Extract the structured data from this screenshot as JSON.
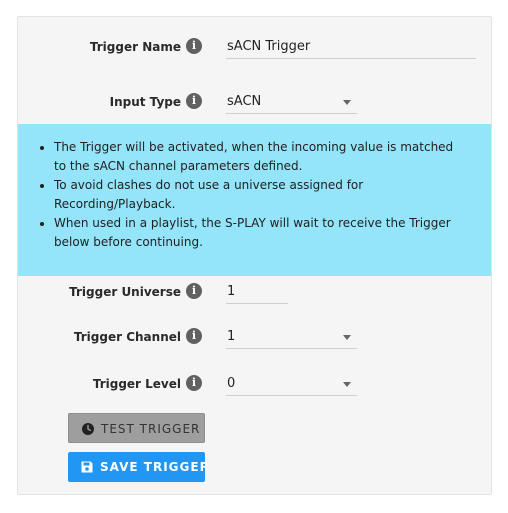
{
  "form": {
    "trigger_name": {
      "label": "Trigger Name",
      "value": "sACN Trigger"
    },
    "input_type": {
      "label": "Input Type",
      "value": "sACN"
    },
    "notice": [
      "The Trigger will be activated, when the incoming value is matched to the sACN channel parameters defined.",
      "To avoid clashes do not use a universe assigned for Recording/Playback.",
      "When used in a playlist, the S-PLAY will wait to receive the Trigger below before continuing."
    ],
    "trigger_universe": {
      "label": "Trigger Universe",
      "value": "1"
    },
    "trigger_channel": {
      "label": "Trigger Channel",
      "value": "1"
    },
    "trigger_level": {
      "label": "Trigger Level",
      "value": "0"
    },
    "info_glyph": "i",
    "test_button": "TEST TRIGGER",
    "save_button": "SAVE TRIGGER"
  },
  "icons": {
    "info": "info-icon",
    "clock": "clock-icon",
    "save": "floppy-disk-icon"
  },
  "colors": {
    "notice_bg": "#94e4fa",
    "save_bg": "#2196f3",
    "test_bg": "#9e9e9e"
  }
}
